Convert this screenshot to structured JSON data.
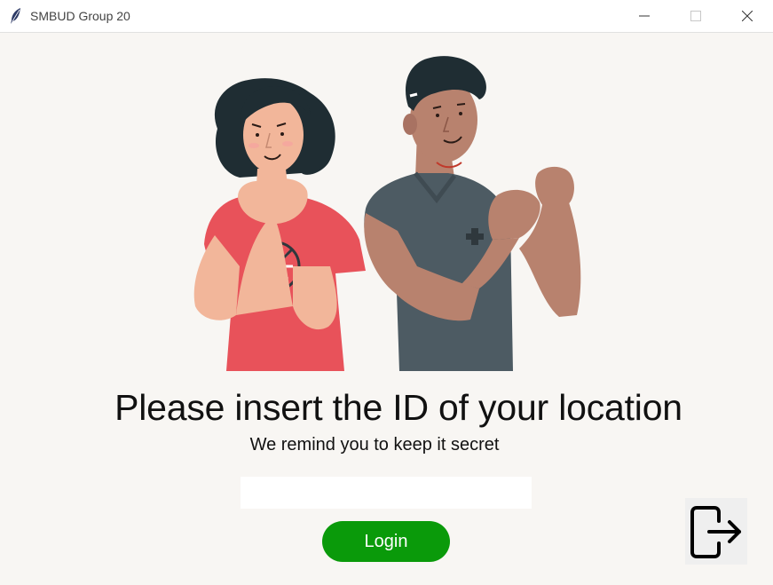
{
  "window": {
    "title": "SMBUD Group 20",
    "app_icon": "feather-icon",
    "controls": [
      "minimize-icon",
      "maximize-icon",
      "close-icon"
    ]
  },
  "main": {
    "heading": "Please insert the ID of your location",
    "subheading": "We remind you to keep it secret",
    "id_input": {
      "value": "",
      "placeholder": ""
    },
    "login_label": "Login",
    "logout_icon": "logout-icon"
  },
  "colors": {
    "background": "#f8f6f3",
    "login_button": "#0a9a0a",
    "woman_shirt": "#e8525a",
    "man_shirt": "#4d5b63"
  }
}
